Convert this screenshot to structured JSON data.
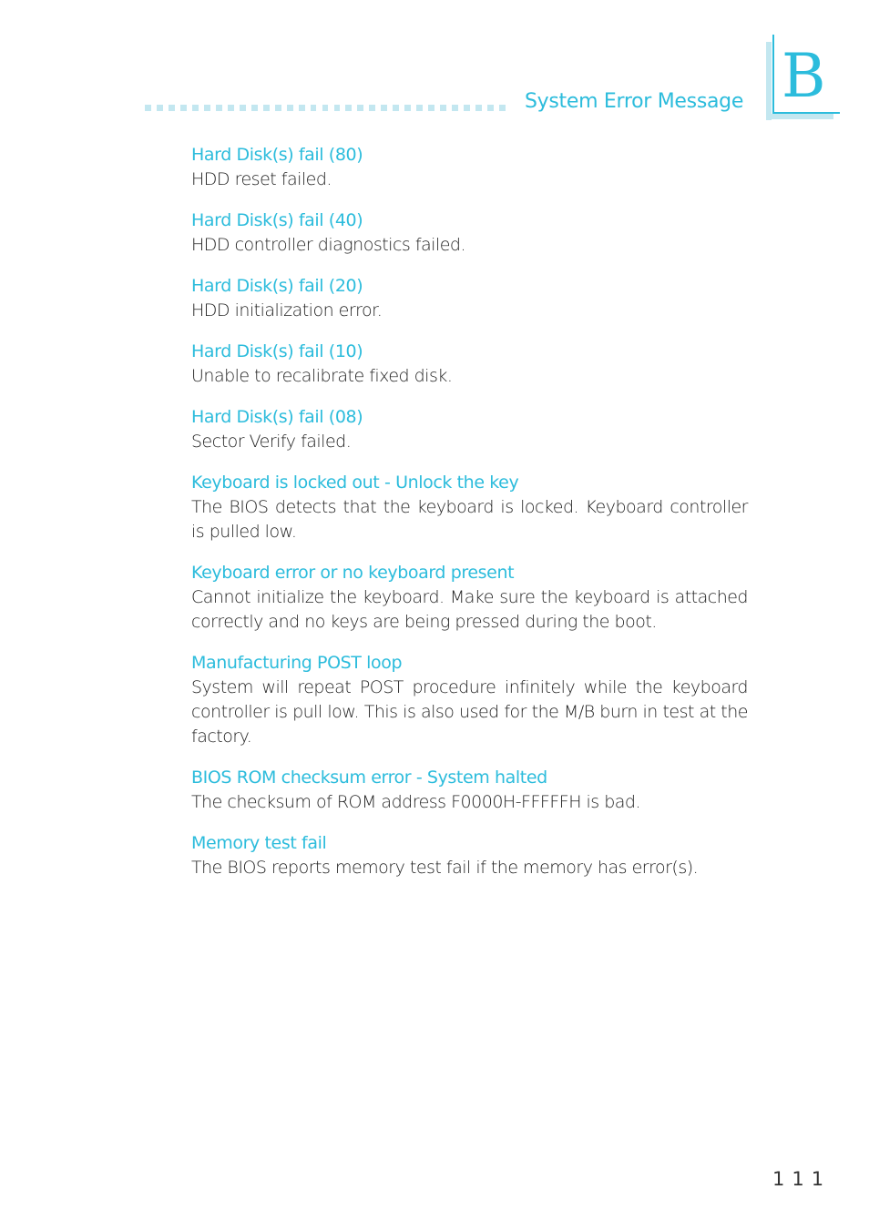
{
  "header": {
    "section_title": "System Error Message",
    "appendix_letter": "B",
    "accent_color": "#2cbcdc",
    "accent_light_color": "#c3e7f0"
  },
  "entries": [
    {
      "title": "Hard Disk(s) fail (80)",
      "description": "HDD reset failed."
    },
    {
      "title": "Hard Disk(s) fail (40)",
      "description": "HDD controller diagnostics failed."
    },
    {
      "title": "Hard Disk(s) fail (20)",
      "description": "HDD initialization error."
    },
    {
      "title": "Hard Disk(s) fail (10)",
      "description": "Unable to recalibrate fixed disk."
    },
    {
      "title": "Hard Disk(s) fail (08)",
      "description": "Sector Verify failed."
    },
    {
      "title": "Keyboard is locked out - Unlock the key",
      "description": "The BIOS detects that the keyboard is locked. Keyboard controller is pulled low."
    },
    {
      "title": "Keyboard error or no keyboard present",
      "description": "Cannot initialize the keyboard. Make sure the keyboard is attached correctly and no keys are being pressed during the boot."
    },
    {
      "title": "Manufacturing POST loop",
      "description": "System will repeat POST procedure infinitely while the keyboard controller is pull low. This is also used for the M/B burn in test at the factory."
    },
    {
      "title": "BIOS ROM checksum error - System halted",
      "description": "The checksum of ROM address F0000H-FFFFFH is bad."
    },
    {
      "title": "Memory test fail",
      "description": "The BIOS reports memory test fail if the memory has error(s)."
    }
  ],
  "footer": {
    "page_number": "111"
  }
}
